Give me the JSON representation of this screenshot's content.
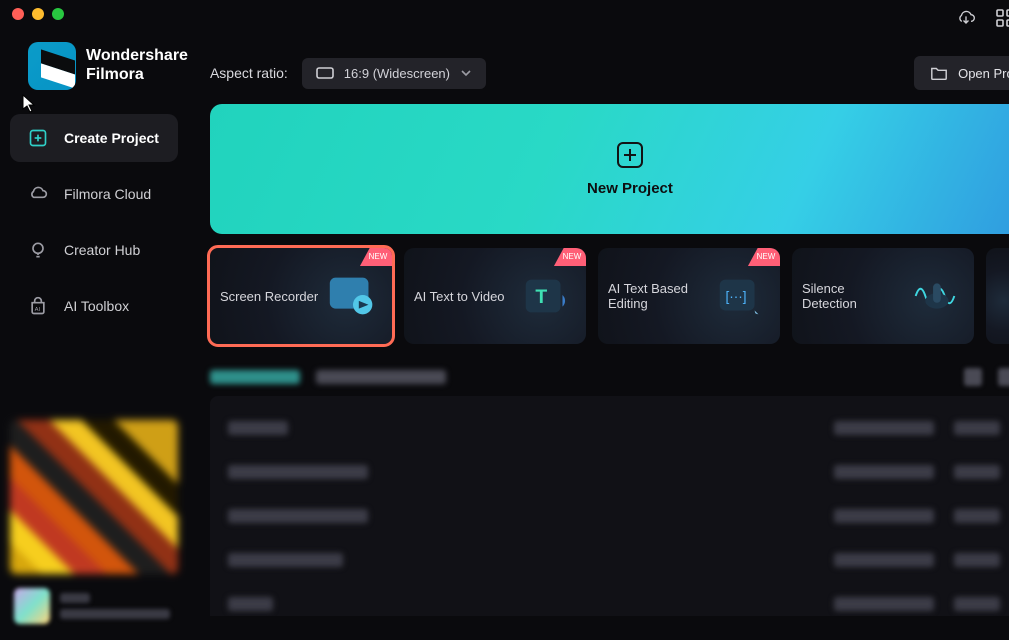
{
  "app": {
    "name_line1": "Wondershare",
    "name_line2": "Filmora"
  },
  "sidebar": {
    "items": [
      {
        "label": "Create Project"
      },
      {
        "label": "Filmora Cloud"
      },
      {
        "label": "Creator Hub"
      },
      {
        "label": "AI Toolbox"
      }
    ]
  },
  "toolbar": {
    "aspect_label": "Aspect ratio:",
    "aspect_value": "16:9 (Widescreen)",
    "open_project": "Open Project"
  },
  "new_project": {
    "label": "New Project"
  },
  "cards": [
    {
      "title": "Screen Recorder",
      "badge": "NEW",
      "selected": true
    },
    {
      "title": "AI Text to Video",
      "badge": "NEW",
      "selected": false
    },
    {
      "title": "AI Text Based Editing",
      "badge": "NEW",
      "selected": false
    },
    {
      "title": "Silence Detection",
      "badge": "",
      "selected": false
    }
  ]
}
